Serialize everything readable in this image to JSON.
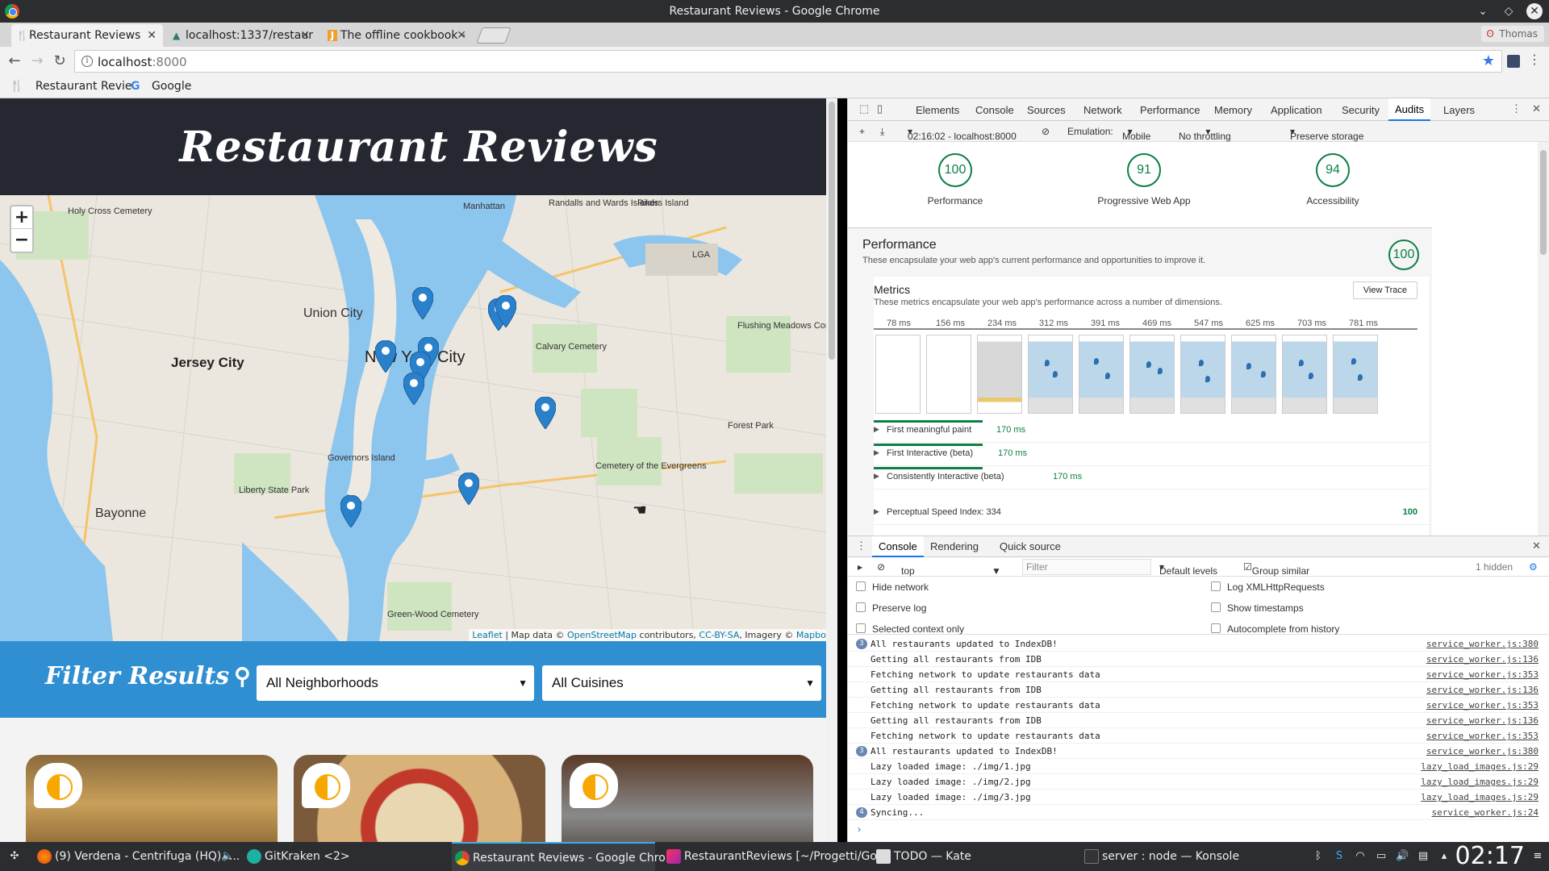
{
  "window": {
    "title": "Restaurant Reviews - Google Chrome"
  },
  "tabs": [
    {
      "label": "Restaurant Reviews",
      "favicon": "fork-knife-icon"
    },
    {
      "label": "localhost:1337/restaur",
      "favicon": "mountain-icon"
    },
    {
      "label": "The offline cookbook -",
      "favicon": "j-icon"
    }
  ],
  "profile": {
    "name": "Thomas"
  },
  "address": {
    "host": "localhost",
    "port": ":8000"
  },
  "bookmarks": [
    {
      "label": "Restaurant Revie",
      "icon": "fork-knife-icon"
    },
    {
      "label": "Google",
      "icon": "google-icon"
    }
  ],
  "site": {
    "title": "Restaurant Reviews",
    "zoom_in": "+",
    "zoom_out": "−",
    "attribution": {
      "leaflet": "Leaflet",
      "map_data": "| Map data ©",
      "osm": "OpenStreetMap",
      "contributors": "contributors,",
      "license": "CC-BY-SA",
      "imagery": ", Imagery ©",
      "mapbox": "Mapbox"
    },
    "map_labels": [
      "Union City",
      "Jersey City",
      "New York City",
      "Bayonne",
      "Liberty State Park",
      "Governors Island",
      "Calvary Cemetery",
      "Forest Park",
      "Cemetery of the Evergreens",
      "Flushing Meadows Corona Park",
      "Rikers Island",
      "Manhattan",
      "Holy Cross Cemetery",
      "LGA",
      "Green-Wood Cemetery",
      "Randalls and Wards Islands"
    ],
    "filter_title": "Filter Results",
    "neighborhood_select": "All Neighborhoods",
    "cuisine_select": "All Cuisines"
  },
  "devtools": {
    "tabs": [
      "Elements",
      "Console",
      "Sources",
      "Network",
      "Performance",
      "Memory",
      "Application",
      "Security",
      "Audits",
      "Layers"
    ],
    "active_tab": "Audits",
    "audit_bar": {
      "report": "02:16:02 - localhost:8000",
      "emulation_label": "Emulation:",
      "emulation_value": "Mobile",
      "throttling": "No throttling",
      "storage": "Preserve storage"
    },
    "scores": [
      {
        "label": "Performance",
        "value": "100"
      },
      {
        "label": "Progressive Web App",
        "value": "91"
      },
      {
        "label": "Accessibility",
        "value": "94"
      }
    ],
    "performance": {
      "title": "Performance",
      "description": "These encapsulate your web app's current performance and opportunities to improve it.",
      "score": "100",
      "metrics_title": "Metrics",
      "metrics_description": "These metrics encapsulate your web app's performance across a number of dimensions.",
      "view_trace": "View Trace",
      "timeline": [
        "78 ms",
        "156 ms",
        "234 ms",
        "312 ms",
        "391 ms",
        "469 ms",
        "547 ms",
        "625 ms",
        "703 ms",
        "781 ms"
      ],
      "metrics": [
        {
          "name": "First meaningful paint",
          "value": "170 ms"
        },
        {
          "name": "First Interactive (beta)",
          "value": "170 ms"
        },
        {
          "name": "Consistently Interactive (beta)",
          "value": "170 ms"
        },
        {
          "name": "Perceptual Speed Index: 334",
          "value": "100"
        }
      ]
    },
    "drawer_tabs": [
      "Console",
      "Rendering",
      "Quick source"
    ],
    "console_bar": {
      "context": "top",
      "filter_placeholder": "Filter",
      "levels": "Default levels",
      "group_similar": "Group similar",
      "hidden": "1 hidden"
    },
    "options": [
      "Hide network",
      "Log XMLHttpRequests",
      "Preserve log",
      "Show timestamps",
      "Selected context only",
      "Autocomplete from history"
    ],
    "logs": [
      {
        "count": "3",
        "msg": "All restaurants updated to IndexDB!",
        "src": "service_worker.js:380"
      },
      {
        "count": "",
        "msg": "Getting all restaurants from IDB",
        "src": "service_worker.js:136"
      },
      {
        "count": "",
        "msg": "Fetching network to update restaurants data",
        "src": "service_worker.js:353"
      },
      {
        "count": "",
        "msg": "Getting all restaurants from IDB",
        "src": "service_worker.js:136"
      },
      {
        "count": "",
        "msg": "Fetching network to update restaurants data",
        "src": "service_worker.js:353"
      },
      {
        "count": "",
        "msg": "Getting all restaurants from IDB",
        "src": "service_worker.js:136"
      },
      {
        "count": "",
        "msg": "Fetching network to update restaurants data",
        "src": "service_worker.js:353"
      },
      {
        "count": "3",
        "msg": "All restaurants updated to IndexDB!",
        "src": "service_worker.js:380"
      },
      {
        "count": "",
        "msg": "Lazy loaded image: ./img/1.jpg",
        "src": "lazy_load_images.js:29"
      },
      {
        "count": "",
        "msg": "Lazy loaded image: ./img/2.jpg",
        "src": "lazy_load_images.js:29"
      },
      {
        "count": "",
        "msg": "Lazy loaded image: ./img/3.jpg",
        "src": "lazy_load_images.js:29"
      },
      {
        "count": "4",
        "msg": "Syncing...",
        "src": "service_worker.js:24"
      }
    ]
  },
  "taskbar": {
    "items": [
      {
        "label": "(9) Verdena - Centrifuga (HQ) -...",
        "icon": "firefox-icon"
      },
      {
        "label": "GitKraken <2>",
        "icon": "gitkraken-icon"
      },
      {
        "label": "Restaurant Reviews - Google Chro...",
        "icon": "chrome-icon"
      },
      {
        "label": "RestaurantReviews [~/Progetti/Go...",
        "icon": "intellij-icon"
      },
      {
        "label": "TODO — Kate",
        "icon": "kate-icon"
      },
      {
        "label": "server : node — Konsole",
        "icon": "konsole-icon"
      }
    ],
    "clock": "02:17"
  },
  "colors": {
    "accent": "#2f8fd1",
    "header": "#252831",
    "score_green": "#0b8043",
    "devtools_blue": "#1a73e8"
  }
}
